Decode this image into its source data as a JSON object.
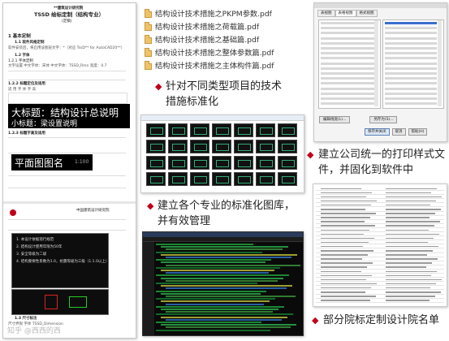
{
  "document": {
    "header_org": "**建筑设计研究院",
    "title": "TSSD 绘标定制（结构专业）",
    "version": "(定稿)",
    "section_1": "1  基本定制",
    "sec_1_1": "1.1 软件风格定制",
    "sec_1_1_text": "软件安装后，将启用该图层文字：*（对应  TssD** for AutoCAD20**）",
    "sec_1_2": "1.2 字体",
    "sec_1_2_1": "1.2.1 字体定制",
    "sec_1_2_1_text": "文字设置  中文字体：宋体  中文字体：TSSD_Rmn  宽度：0.7",
    "sec_1_2_2": "1.2.2 标题定位及适用",
    "sec_1_2_2_text": "适  用  字  体  字  高",
    "big_title_line1": "大标题：结构设计总说明",
    "big_title_line2": "小标题：梁设置说明",
    "sec_1_2_3": "1.2.3 标题字高及适用",
    "plan_title": "平面图图名",
    "plan_scale": "1:100",
    "sec_1_3": "1.3 尺寸标注",
    "sec_1_3_text": "尺寸界限    字体  TSSD_Dimension",
    "watermark": "知乎 @西西的西",
    "stamp_text": "中国建筑设计研究院",
    "dark_panel_lines": [
      "1. 本设计依据现行规范",
      "2. 结构设计使用年限为50年",
      "3. 安全等级为二级",
      "4. 结构重要性系数为1.0，抗震等级为三级（1.1.0以上）"
    ]
  },
  "pdf_files": [
    "结构设计技术措施之PKPM参数.pdf",
    "结构设计技术措施之荷载篇.pdf",
    "结构设计技术措施之基础篇.pdf",
    "结构设计技术措施之整体参数篇.pdf",
    "结构设计技术措施之主体构件篇.pdf"
  ],
  "bullets": {
    "tech_measures": "针对不同类型项目的技术措施标准化",
    "library": "建立各个专业的标准化图库，并有效管理",
    "print_style": "建立公司统一的打印样式文件，并固化到软件中",
    "institutes": "部分院标定制设计院名单"
  },
  "print_dialog": {
    "tabs": [
      "表视图",
      "表格视图",
      "格式视图"
    ],
    "bottom_buttons": [
      "编辑线宽(L)...",
      "另存为(S)..."
    ],
    "action_buttons": [
      "保存并关闭",
      "取消",
      "帮助(H)"
    ]
  },
  "colors": {
    "accent_red": "#c0001a",
    "dark_bg": "#0d0d0d",
    "text": "#222222"
  }
}
